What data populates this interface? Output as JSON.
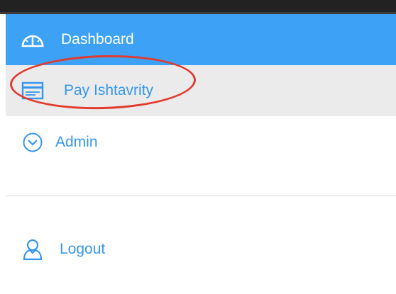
{
  "sidebar": {
    "items": [
      {
        "label": "Dashboard",
        "icon": "speedometer-icon",
        "active": true
      },
      {
        "label": "Pay Ishtavrity",
        "icon": "credit-card-icon",
        "highlighted": true
      },
      {
        "label": "Admin",
        "icon": "chevron-circle-down-icon"
      },
      {
        "label": "Logout",
        "icon": "user-icon"
      }
    ]
  },
  "colors": {
    "active_bg": "#3da2f5",
    "hover_bg": "#ebebeb",
    "link_text": "#3596ec",
    "annotation": "#e23a2e"
  }
}
